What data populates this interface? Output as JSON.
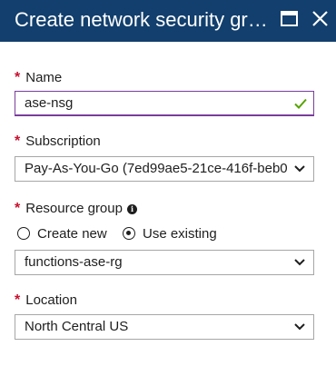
{
  "header": {
    "title": "Create network security gro...",
    "maximize_icon": "maximize-icon",
    "close_icon": "close-icon"
  },
  "form": {
    "required_marker": "*",
    "name": {
      "label": "Name",
      "value": "ase-nsg",
      "valid_icon": "checkmark-icon"
    },
    "subscription": {
      "label": "Subscription",
      "value": "Pay-As-You-Go (7ed99ae5-21ce-416f-beb0"
    },
    "resource_group": {
      "label": "Resource group",
      "info_icon": "info-icon",
      "options": [
        {
          "label": "Create new",
          "selected": false
        },
        {
          "label": "Use existing",
          "selected": true
        }
      ],
      "value": "functions-ase-rg"
    },
    "location": {
      "label": "Location",
      "value": "North Central US"
    }
  },
  "colors": {
    "header_bg": "#123f6d",
    "required": "#c8102e",
    "focus_border": "#7a3d9c",
    "valid_check": "#57a300"
  }
}
